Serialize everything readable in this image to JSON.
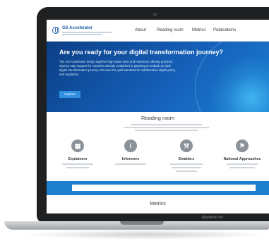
{
  "header": {
    "logo_title": "GS Accelerator",
    "nav": [
      "About",
      "Reading room",
      "Metrics",
      "Publications"
    ]
  },
  "hero": {
    "title": "Are you ready for your digital transformation journey?",
    "body": "The GS Accelerator brings together high-value tools and resources offering practical, step-by-step support for countries already embarked or planning to embark on their digital transformation journey. Discover the gold standard for collaborative digital policy and regulation.",
    "button": "Explore"
  },
  "reading_room": {
    "title": "Reading room",
    "cards": [
      {
        "title": "Explainers",
        "icon": "book-icon"
      },
      {
        "title": "Informers",
        "icon": "info-icon"
      },
      {
        "title": "Enablers",
        "icon": "tools-icon"
      },
      {
        "title": "National Approaches",
        "icon": "flag-icon"
      }
    ]
  },
  "metrics": {
    "title": "Metrics"
  },
  "device": {
    "brand": "MacBook Pro"
  },
  "colors": {
    "primary": "#1d5fa8",
    "hero": "#155fb8",
    "band": "#1e7fcf"
  }
}
